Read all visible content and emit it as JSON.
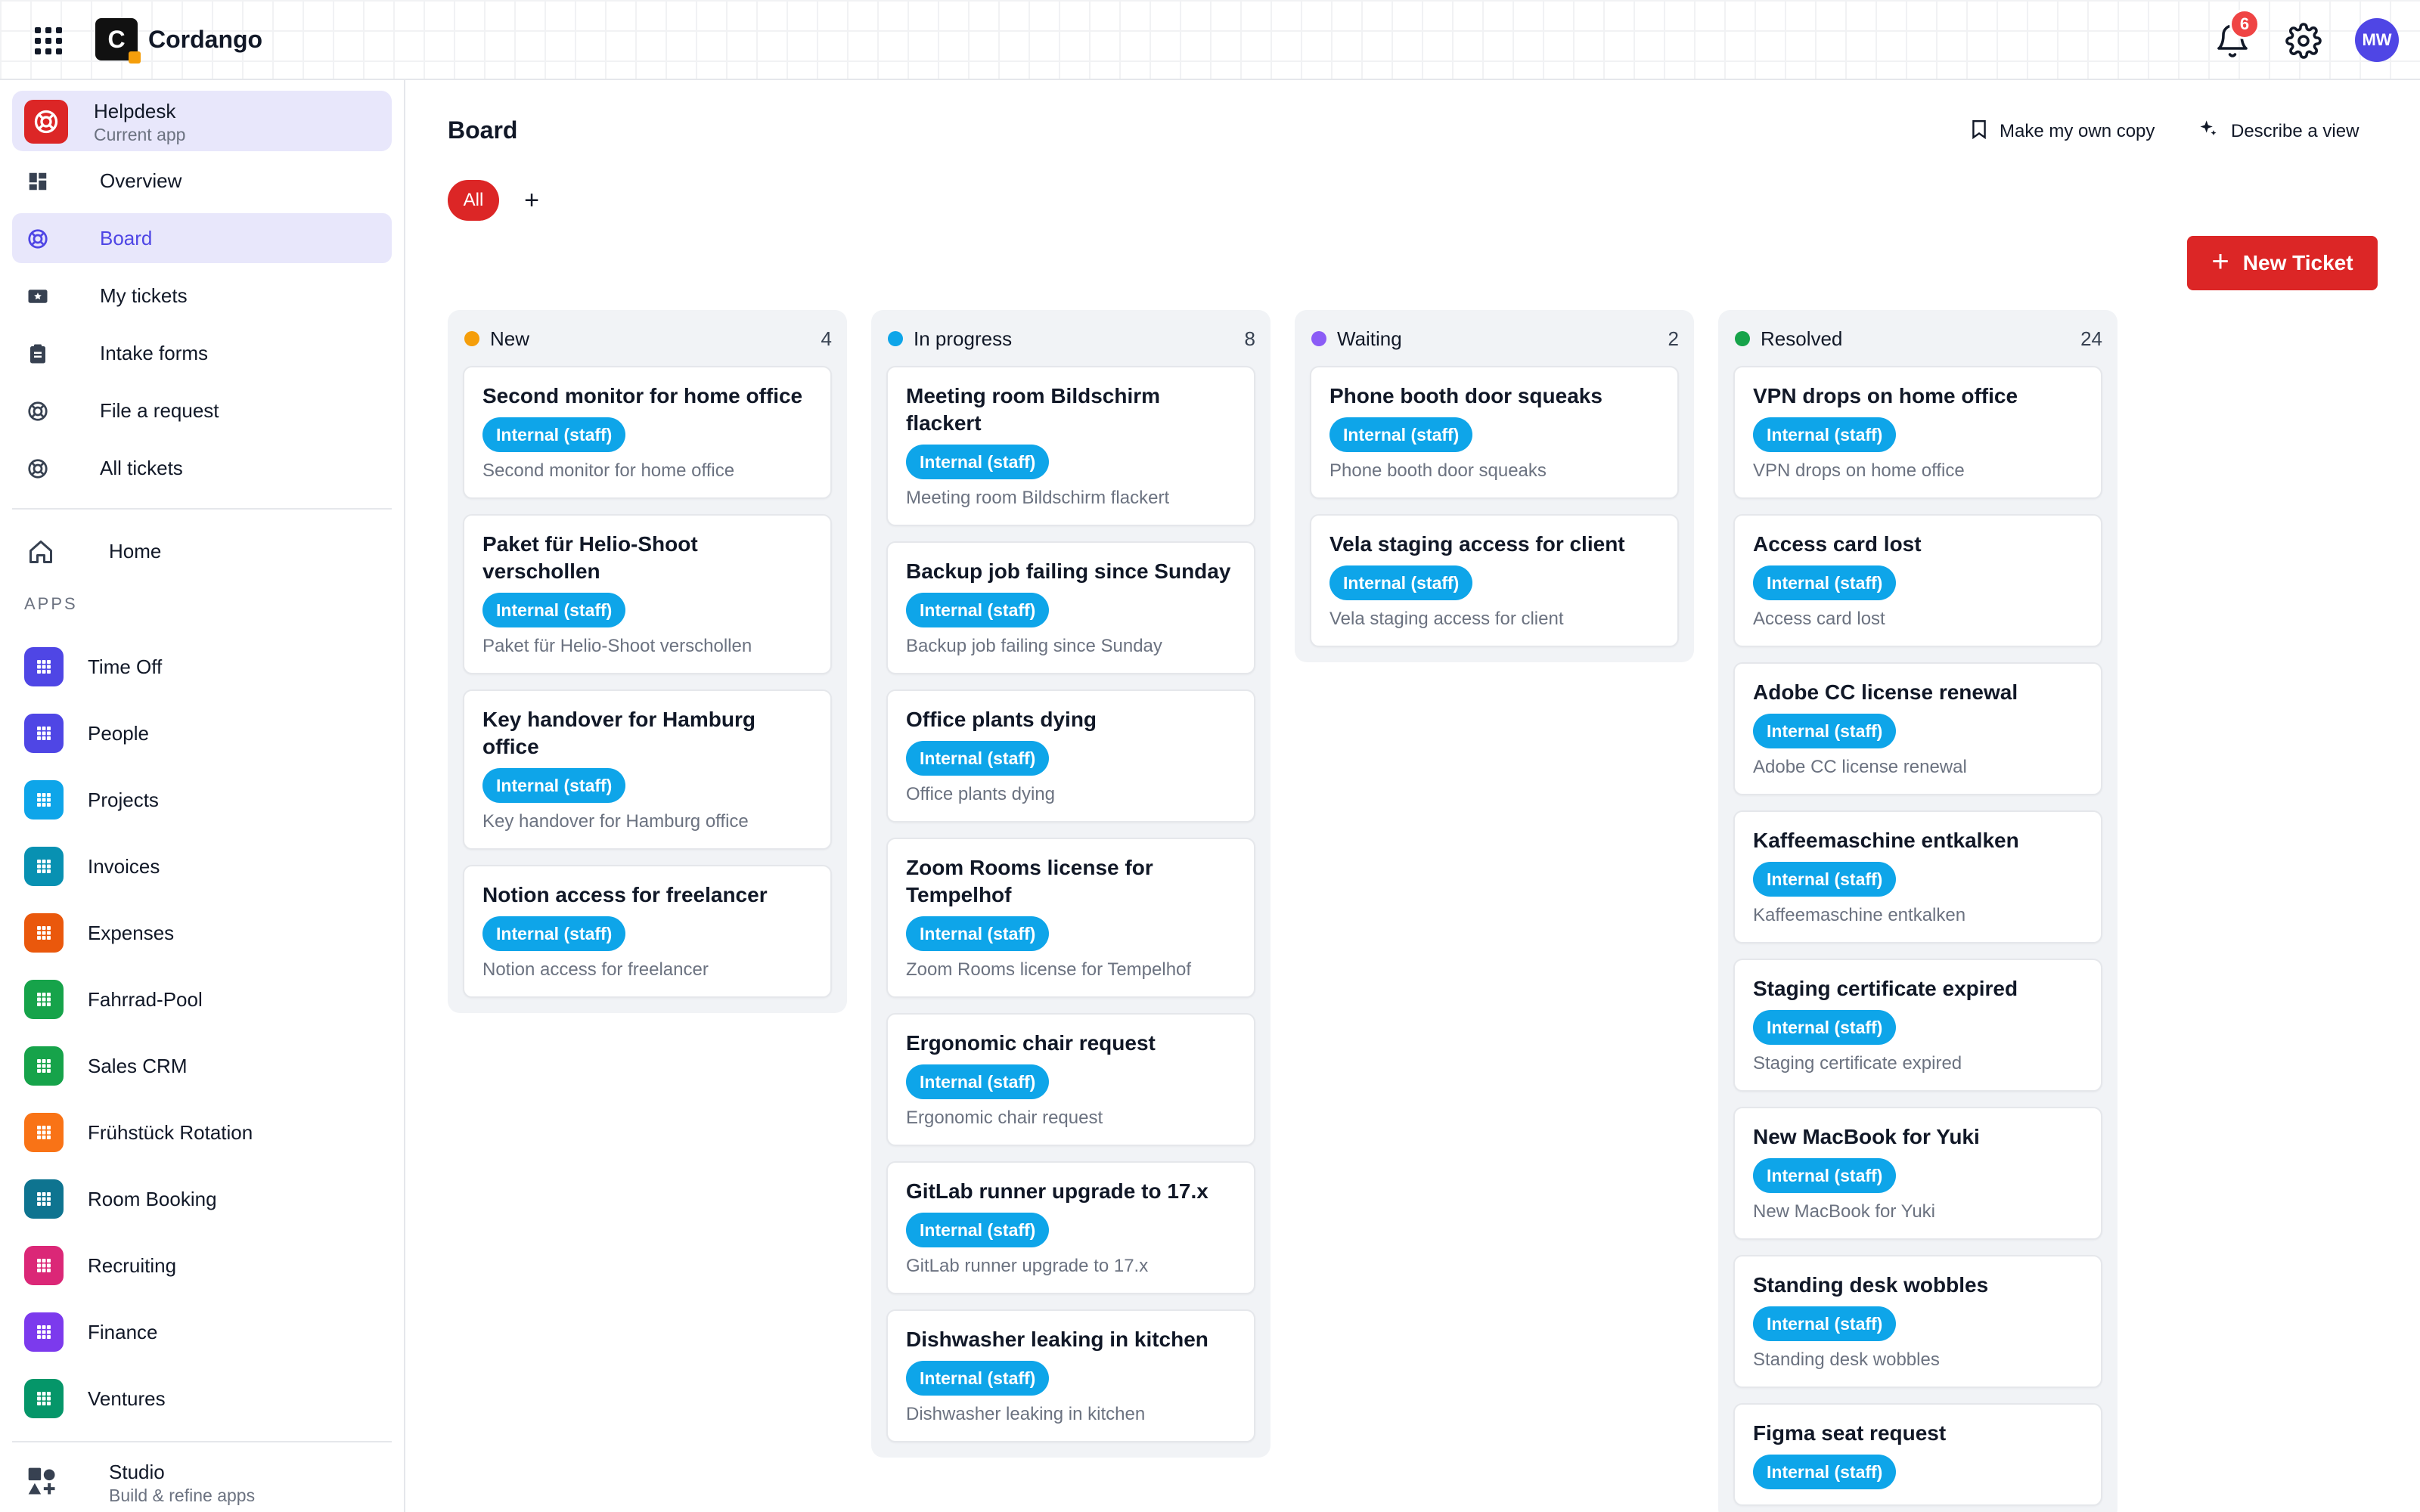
{
  "brand": {
    "name": "Cordango",
    "logo_letter": "C"
  },
  "topbar": {
    "notifications_count": "6",
    "avatar_initials": "MW"
  },
  "sidebar": {
    "current_app": {
      "name": "Helpdesk",
      "subtitle": "Current app"
    },
    "nav": [
      {
        "label": "Overview",
        "icon": "dashboard-icon",
        "active": false
      },
      {
        "label": "Board",
        "icon": "helpdesk-icon",
        "active": true
      },
      {
        "label": "My tickets",
        "icon": "ticket-star-icon",
        "active": false
      },
      {
        "label": "Intake forms",
        "icon": "clipboard-icon",
        "active": false
      },
      {
        "label": "File a request",
        "icon": "lifebuoy-icon",
        "active": false
      },
      {
        "label": "All tickets",
        "icon": "lifebuoy-icon",
        "active": false
      }
    ],
    "home_label": "Home",
    "apps_heading": "APPS",
    "apps": [
      {
        "label": "Time Off",
        "color": "#4f46e5",
        "icon": "grid-icon"
      },
      {
        "label": "People",
        "color": "#4f46e5",
        "icon": "people-icon"
      },
      {
        "label": "Projects",
        "color": "#0ea5e9",
        "icon": "checkbox-icon"
      },
      {
        "label": "Invoices",
        "color": "#0891b2",
        "icon": "square-icon"
      },
      {
        "label": "Expenses",
        "color": "#ea580c",
        "icon": "money-icon"
      },
      {
        "label": "Fahrrad-Pool",
        "color": "#16a34a",
        "icon": "grid-icon"
      },
      {
        "label": "Sales CRM",
        "color": "#16a34a",
        "icon": "handshake-icon"
      },
      {
        "label": "Frühstück Rotation",
        "color": "#f97316",
        "icon": "grid-icon"
      },
      {
        "label": "Room Booking",
        "color": "#0e7490",
        "icon": "calendar-icon"
      },
      {
        "label": "Recruiting",
        "color": "#db2777",
        "icon": "badge-icon"
      },
      {
        "label": "Finance",
        "color": "#7c3aed",
        "icon": "chart-icon"
      },
      {
        "label": "Ventures",
        "color": "#059669",
        "icon": "grid-icon"
      }
    ],
    "studio": {
      "title": "Studio",
      "subtitle": "Build & refine apps"
    }
  },
  "main": {
    "title": "Board",
    "actions": {
      "copy": "Make my own copy",
      "describe": "Describe a view"
    },
    "filter_all": "All",
    "filter_add": "+",
    "new_ticket": "New Ticket"
  },
  "board": {
    "columns": [
      {
        "title": "New",
        "count": "4",
        "color": "#f59e0b",
        "cards": [
          {
            "title": "Second monitor for home office",
            "tag": "Internal (staff)",
            "subtitle": "Second monitor for home office"
          },
          {
            "title": "Paket für Helio-Shoot verschollen",
            "tag": "Internal (staff)",
            "subtitle": "Paket für Helio-Shoot verschollen"
          },
          {
            "title": "Key handover for Hamburg office",
            "tag": "Internal (staff)",
            "subtitle": "Key handover for Hamburg office"
          },
          {
            "title": "Notion access for freelancer",
            "tag": "Internal (staff)",
            "subtitle": "Notion access for freelancer"
          }
        ]
      },
      {
        "title": "In progress",
        "count": "8",
        "color": "#0ea5e9",
        "cards": [
          {
            "title": "Meeting room Bildschirm flackert",
            "tag": "Internal (staff)",
            "subtitle": "Meeting room Bildschirm flackert"
          },
          {
            "title": "Backup job failing since Sunday",
            "tag": "Internal (staff)",
            "subtitle": "Backup job failing since Sunday"
          },
          {
            "title": "Office plants dying",
            "tag": "Internal (staff)",
            "subtitle": "Office plants dying"
          },
          {
            "title": "Zoom Rooms license for Tempelhof",
            "tag": "Internal (staff)",
            "subtitle": "Zoom Rooms license for Tempelhof"
          },
          {
            "title": "Ergonomic chair request",
            "tag": "Internal (staff)",
            "subtitle": "Ergonomic chair request"
          },
          {
            "title": "GitLab runner upgrade to 17.x",
            "tag": "Internal (staff)",
            "subtitle": "GitLab runner upgrade to 17.x"
          },
          {
            "title": "Dishwasher leaking in kitchen",
            "tag": "Internal (staff)",
            "subtitle": "Dishwasher leaking in kitchen"
          }
        ]
      },
      {
        "title": "Waiting",
        "count": "2",
        "color": "#8b5cf6",
        "cards": [
          {
            "title": "Phone booth door squeaks",
            "tag": "Internal (staff)",
            "subtitle": "Phone booth door squeaks"
          },
          {
            "title": "Vela staging access for client",
            "tag": "Internal (staff)",
            "subtitle": "Vela staging access for client"
          }
        ]
      },
      {
        "title": "Resolved",
        "count": "24",
        "color": "#16a34a",
        "cards": [
          {
            "title": "VPN drops on home office",
            "tag": "Internal (staff)",
            "subtitle": "VPN drops on home office"
          },
          {
            "title": "Access card lost",
            "tag": "Internal (staff)",
            "subtitle": "Access card lost"
          },
          {
            "title": "Adobe CC license renewal",
            "tag": "Internal (staff)",
            "subtitle": "Adobe CC license renewal"
          },
          {
            "title": "Kaffeemaschine entkalken",
            "tag": "Internal (staff)",
            "subtitle": "Kaffeemaschine entkalken"
          },
          {
            "title": "Staging certificate expired",
            "tag": "Internal (staff)",
            "subtitle": "Staging certificate expired"
          },
          {
            "title": "New MacBook for Yuki",
            "tag": "Internal (staff)",
            "subtitle": "New MacBook for Yuki"
          },
          {
            "title": "Standing desk wobbles",
            "tag": "Internal (staff)",
            "subtitle": "Standing desk wobbles"
          },
          {
            "title": "Figma seat request",
            "tag": "Internal (staff)",
            "subtitle": ""
          }
        ]
      }
    ]
  }
}
